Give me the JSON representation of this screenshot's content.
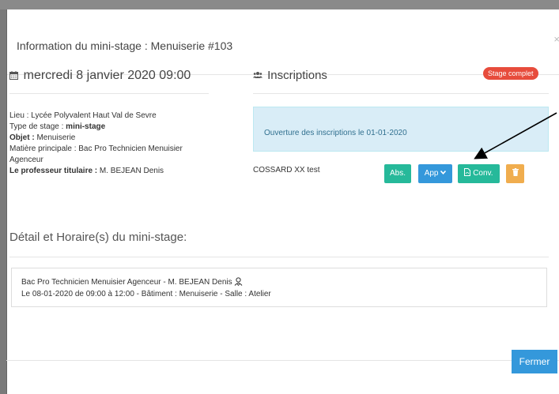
{
  "modal": {
    "title": "Information du mini-stage : Menuiserie #103",
    "close_glyph": "×"
  },
  "left": {
    "date": "mercredi 8 janvier 2020 09:00",
    "lieu_label": "Lieu : ",
    "lieu_value": "Lycée Polyvalent Haut Val de Sevre",
    "type_label": "Type de stage : ",
    "type_value": "mini-stage",
    "objet_label": "Objet : ",
    "objet_value": "Menuiserie",
    "matiere_label": "Matière principale : ",
    "matiere_value": "Bac Pro Technicien Menuisier Agenceur",
    "prof_label": "Le professeur titulaire : ",
    "prof_value": "M. BEJEAN Denis"
  },
  "right": {
    "heading": "Inscriptions",
    "badge": "Stage complet",
    "alert": "Ouverture des inscriptions le 01-01-2020",
    "student": "COSSARD XX test",
    "buttons": {
      "abs": "Abs.",
      "app": "App",
      "conv": "Conv."
    }
  },
  "detail": {
    "heading": "Détail et Horaire(s) du mini-stage:",
    "line1": "Bac Pro Technicien Menuisier Agenceur - M. BEJEAN Denis",
    "line2": "Le 08-01-2020 de 09:00 à 12:00 - Bâtiment : Menuiserie - Salle : Atelier"
  },
  "footer": {
    "close_label": "Fermer"
  },
  "colors": {
    "teal": "#26b99a",
    "blue": "#3498db",
    "orange": "#f0ad4e",
    "red": "#e74c3c",
    "alert_bg": "#d9edf7"
  },
  "icons": {
    "calendar": "calendar-icon",
    "users": "users-icon",
    "pdf": "file-pdf-icon",
    "trash": "trash-icon",
    "chevron": "chevron-down-icon",
    "teacher": "teacher-icon"
  }
}
